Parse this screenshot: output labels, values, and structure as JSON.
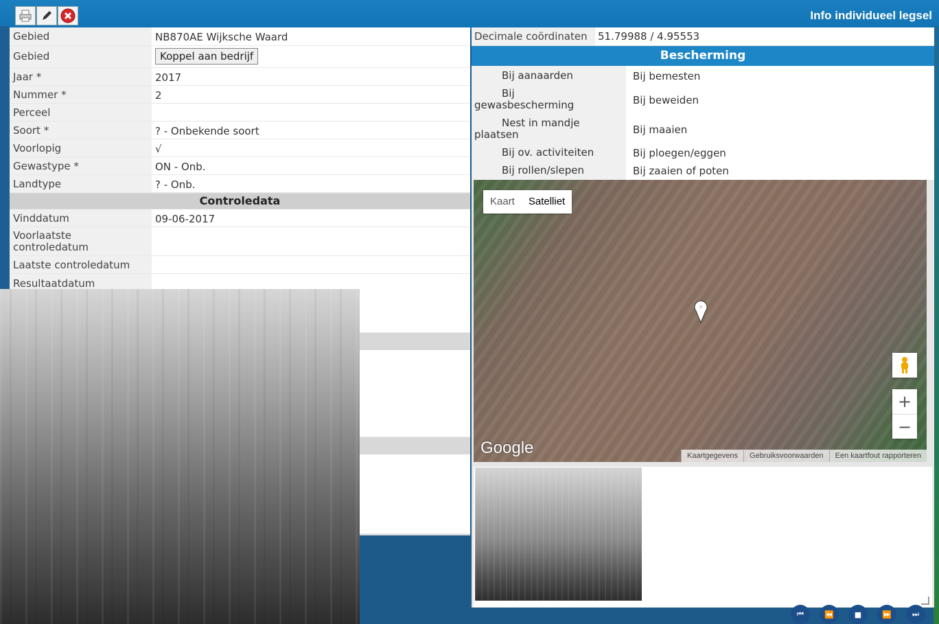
{
  "window": {
    "title": "Info individueel legsel"
  },
  "toolbar": {
    "print_icon": "print-icon",
    "edit_icon": "pencil-icon",
    "close_icon": "close-icon"
  },
  "details": {
    "rows": [
      {
        "label": "Gebied",
        "value": "NB870AE Wijksche Waard"
      },
      {
        "label": "Gebied",
        "button": "Koppel aan bedrijf"
      },
      {
        "label": "Jaar *",
        "value": "2017"
      },
      {
        "label": "Nummer *",
        "value": "2"
      },
      {
        "label": "Perceel",
        "value": ""
      },
      {
        "label": "Soort *",
        "value": "? - Onbekende soort"
      },
      {
        "label": "Voorlopig",
        "value": "√"
      },
      {
        "label": "Gewastype *",
        "value": "ON - Onb."
      },
      {
        "label": "Landtype",
        "value": "? - Onb."
      }
    ],
    "controle_header": "Controledata",
    "controle_rows": [
      {
        "label": "Vinddatum",
        "value": "09-06-2017"
      },
      {
        "label": "Voorlaatste controledatum",
        "value": ""
      },
      {
        "label": "Laatste controledatum",
        "value": ""
      },
      {
        "label": "Resultaatdatum",
        "value": ""
      }
    ]
  },
  "coords": {
    "label": "Decimale coördinaten",
    "value": "51.79988 / 4.95553"
  },
  "bescherming": {
    "header": "Bescherming",
    "left": [
      "Bij aanaarden",
      "Bij gewasbescherming",
      "Nest in mandje plaatsen",
      "Bij ov. activiteiten",
      "Bij rollen/slepen"
    ],
    "right": [
      "Bij bemesten",
      "Bij beweiden",
      "Bij maaien",
      "Bij ploegen/eggen",
      "Bij zaaien of poten"
    ]
  },
  "map": {
    "type_map": "Kaart",
    "type_satellite": "Satelliet",
    "logo": "Google",
    "footer": [
      "Kaartgegevens",
      "Gebruiksvoorwaarden",
      "Een kaartfout rapporteren"
    ],
    "zoom_in": "+",
    "zoom_out": "−"
  }
}
